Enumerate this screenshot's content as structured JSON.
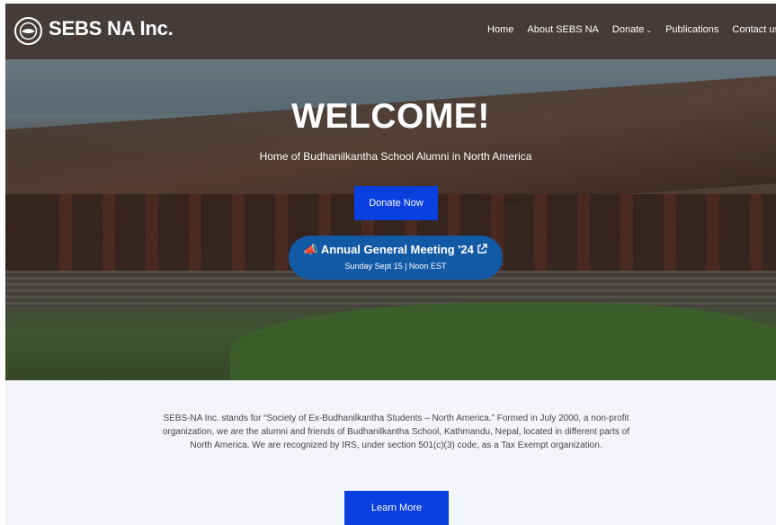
{
  "header": {
    "brand": "SEBS NA Inc.",
    "nav": [
      {
        "label": "Home",
        "dropdown": false
      },
      {
        "label": "About SEBS NA",
        "dropdown": false
      },
      {
        "label": "Donate",
        "dropdown": true
      },
      {
        "label": "Publications",
        "dropdown": false
      },
      {
        "label": "Contact us",
        "dropdown": false
      }
    ]
  },
  "hero": {
    "title": "WELCOME!",
    "subtitle": "Home of Budhanilkantha School Alumni in North America",
    "donate_label": "Donate Now",
    "event": {
      "emoji": "📣",
      "title": "Annual General Meeting '24",
      "detail": "Sunday Sept 15 | Noon EST"
    }
  },
  "info": {
    "description": "SEBS-NA Inc. stands for “Society of Ex-Budhanilkantha Students – North America.” Formed in July 2000, a non-profit organization, we are the alumni and friends of Budhanilkantha School, Kathmandu, Nepal, located in different parts of North America. We are recognized by IRS, under section 501(c)(3) code, as a Tax Exempt organization.",
    "learn_label": "Learn More"
  },
  "colors": {
    "header_bg": "#453c3a",
    "button_blue": "#0a3fe0",
    "event_pill": "#135aa6",
    "info_bg": "#f3f5f9"
  }
}
